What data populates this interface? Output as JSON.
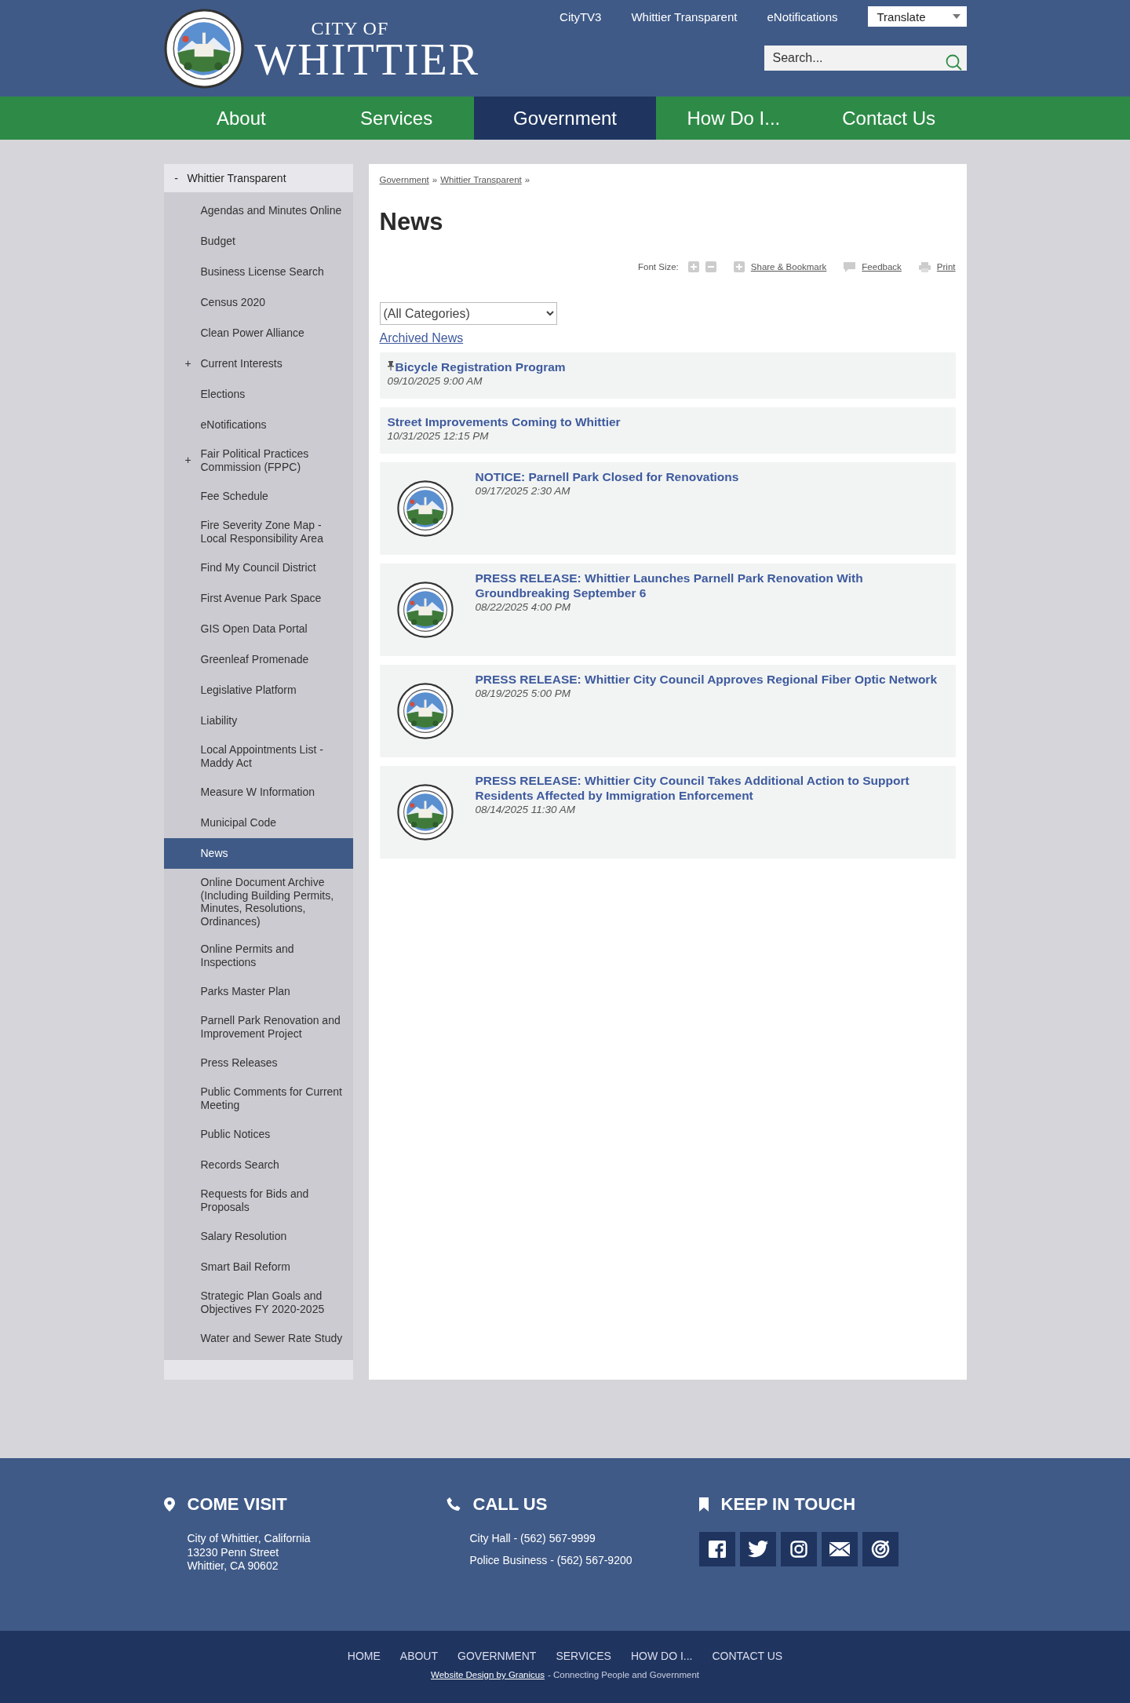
{
  "header": {
    "logo_small": "CITY OF",
    "logo_large": "WHITTIER",
    "links": [
      "CityTV3",
      "Whittier Transparent",
      "eNotifications"
    ],
    "translate": "Translate",
    "search": {
      "placeholder": "Search..."
    }
  },
  "nav": [
    {
      "label": "About",
      "selected": false
    },
    {
      "label": "Services",
      "selected": false
    },
    {
      "label": "Government",
      "selected": true
    },
    {
      "label": "How Do I...",
      "selected": false
    },
    {
      "label": "Contact Us",
      "selected": false
    }
  ],
  "sidebar": {
    "parent": {
      "label": "Whittier Transparent",
      "toggle": "-"
    },
    "items": [
      {
        "label": "Agendas and Minutes Online",
        "selected": false
      },
      {
        "label": "Budget",
        "selected": false
      },
      {
        "label": "Business License Search",
        "selected": false
      },
      {
        "label": "Census 2020",
        "selected": false
      },
      {
        "label": "Clean Power Alliance",
        "selected": false
      },
      {
        "label": "Current Interests",
        "selected": false,
        "toggle": "+"
      },
      {
        "label": "Elections",
        "selected": false
      },
      {
        "label": "eNotifications",
        "selected": false
      },
      {
        "label": "Fair Political Practices Commission (FPPC)",
        "selected": false,
        "toggle": "+"
      },
      {
        "label": "Fee Schedule",
        "selected": false
      },
      {
        "label": "Fire Severity Zone Map - Local Responsibility Area",
        "selected": false
      },
      {
        "label": "Find My Council District",
        "selected": false
      },
      {
        "label": "First Avenue Park Space",
        "selected": false
      },
      {
        "label": "GIS Open Data Portal",
        "selected": false
      },
      {
        "label": "Greenleaf Promenade",
        "selected": false
      },
      {
        "label": "Legislative Platform",
        "selected": false
      },
      {
        "label": "Liability",
        "selected": false
      },
      {
        "label": "Local Appointments List - Maddy Act",
        "selected": false
      },
      {
        "label": "Measure W Information",
        "selected": false
      },
      {
        "label": "Municipal Code",
        "selected": false
      },
      {
        "label": "News",
        "selected": true
      },
      {
        "label": "Online Document Archive (Including Building Permits, Minutes, Resolutions, Ordinances)",
        "selected": false
      },
      {
        "label": "Online Permits and Inspections",
        "selected": false
      },
      {
        "label": "Parks Master Plan",
        "selected": false
      },
      {
        "label": "Parnell Park Renovation and Improvement Project",
        "selected": false
      },
      {
        "label": "Press Releases",
        "selected": false
      },
      {
        "label": "Public Comments for Current Meeting",
        "selected": false
      },
      {
        "label": "Public Notices",
        "selected": false
      },
      {
        "label": "Records Search",
        "selected": false
      },
      {
        "label": "Requests for Bids and Proposals",
        "selected": false
      },
      {
        "label": "Salary Resolution",
        "selected": false
      },
      {
        "label": "Smart Bail Reform",
        "selected": false
      },
      {
        "label": "Strategic Plan Goals and Objectives FY 2020-2025",
        "selected": false
      },
      {
        "label": "Water and Sewer Rate Study",
        "selected": false
      }
    ]
  },
  "breadcrumb": [
    "Government",
    "Whittier Transparent"
  ],
  "breadcrumb_separator": "»",
  "page_title": "News",
  "tools": {
    "font_size_label": "Font Size:",
    "share": "Share & Bookmark",
    "feedback": "Feedback",
    "print": "Print"
  },
  "category_filter": "(All Categories)",
  "archived_link": "Archived News",
  "news": [
    {
      "kind": "plain",
      "pinned": true,
      "title": "Bicycle Registration Program",
      "date": "09/10/2025 9:00 AM"
    },
    {
      "kind": "plain",
      "pinned": false,
      "title": "Street Improvements Coming to Whittier",
      "date": "10/31/2025 12:15 PM"
    },
    {
      "kind": "thumb",
      "pinned": false,
      "title": "NOTICE: Parnell Park Closed for Renovations",
      "date": "09/17/2025 2:30 AM"
    },
    {
      "kind": "thumb",
      "pinned": false,
      "title": "PRESS RELEASE: Whittier Launches Parnell Park Renovation With Groundbreaking September 6",
      "date": "08/22/2025 4:00 PM"
    },
    {
      "kind": "thumb",
      "pinned": false,
      "title": "PRESS RELEASE: Whittier City Council Approves Regional Fiber Optic Network",
      "date": "08/19/2025 5:00 PM"
    },
    {
      "kind": "thumb",
      "pinned": false,
      "title": "PRESS RELEASE: Whittier City Council Takes Additional Action to Support Residents Affected by Immigration Enforcement",
      "date": "08/14/2025 11:30 AM"
    }
  ],
  "footer": {
    "visit": {
      "heading": "COME VISIT",
      "lines": [
        "City of Whittier, California",
        "13230 Penn Street",
        "Whittier, CA 90602"
      ]
    },
    "call": {
      "heading": "CALL US",
      "lines": [
        "City Hall - (562) 567-9999",
        "Police Business - (562) 567-9200"
      ]
    },
    "touch": {
      "heading": "KEEP IN TOUCH",
      "social": [
        {
          "kind": "facebook"
        },
        {
          "kind": "twitter"
        },
        {
          "kind": "instagram"
        },
        {
          "kind": "email"
        },
        {
          "kind": "target"
        }
      ]
    },
    "links": [
      "HOME",
      "ABOUT",
      "GOVERNMENT",
      "SERVICES",
      "HOW DO I...",
      "CONTACT US"
    ],
    "credit_link": "Website Design by Granicus",
    "credit_text": "- Connecting People and Government"
  }
}
